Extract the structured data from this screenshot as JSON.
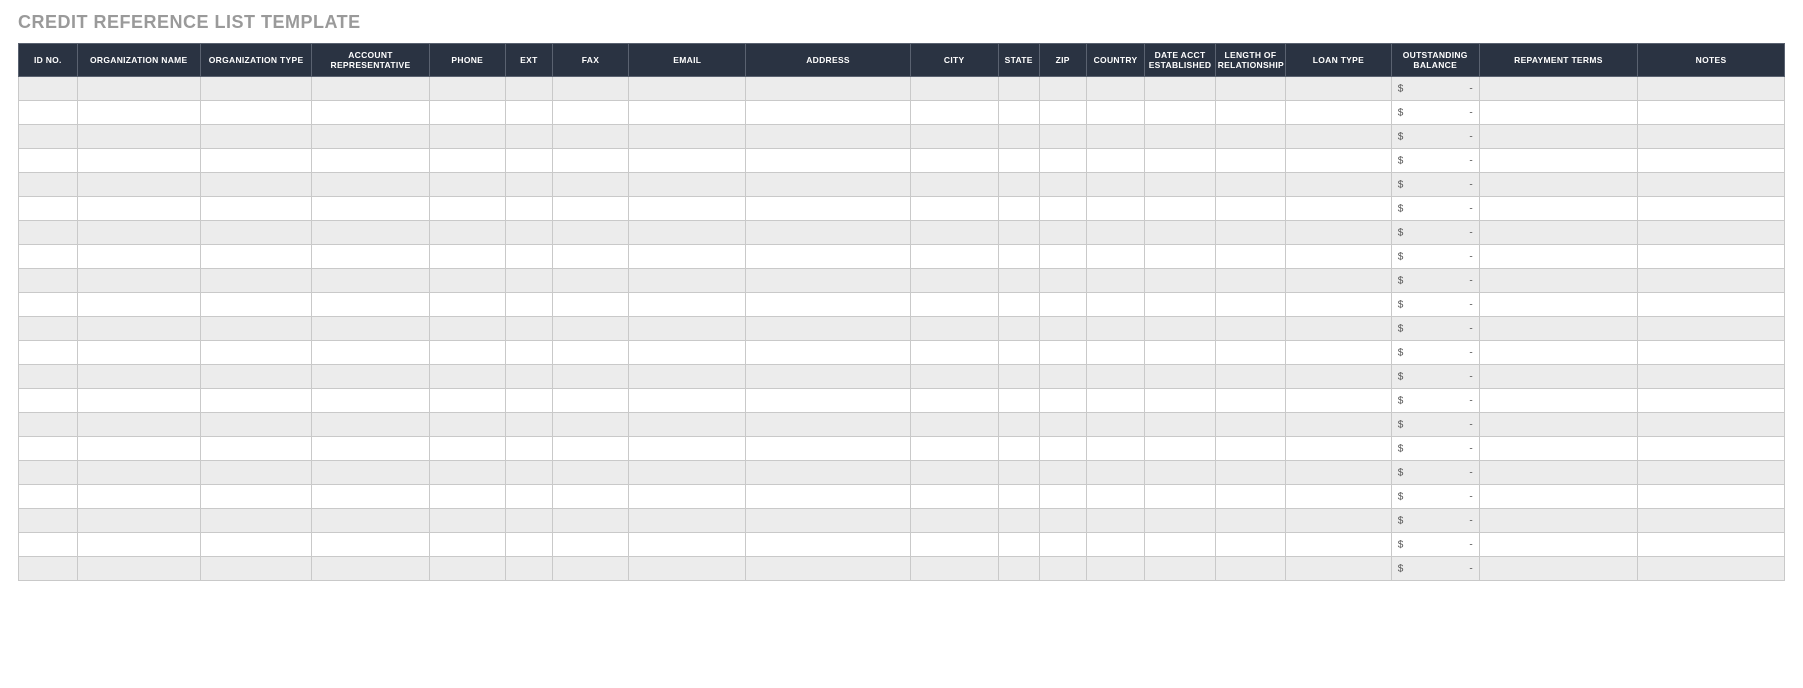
{
  "title": "CREDIT REFERENCE LIST TEMPLATE",
  "columns": [
    "ID NO.",
    "ORGANIZATION NAME",
    "ORGANIZATION TYPE",
    "ACCOUNT REPRESENTATIVE",
    "PHONE",
    "EXT",
    "FAX",
    "EMAIL",
    "ADDRESS",
    "CITY",
    "STATE",
    "ZIP",
    "COUNTRY",
    "DATE ACCT ESTABLISHED",
    "LENGTH OF RELATIONSHIP",
    "LOAN TYPE",
    "OUTSTANDING BALANCE",
    "REPAYMENT TERMS",
    "NOTES"
  ],
  "balance_symbol": "$",
  "balance_placeholder": "-",
  "row_count": 21,
  "rows": [
    {
      "id_no": "",
      "organization_name": "",
      "organization_type": "",
      "account_representative": "",
      "phone": "",
      "ext": "",
      "fax": "",
      "email": "",
      "address": "",
      "city": "",
      "state": "",
      "zip": "",
      "country": "",
      "date_acct_established": "",
      "length_of_relationship": "",
      "loan_type": "",
      "outstanding_balance": "",
      "repayment_terms": "",
      "notes": ""
    },
    {
      "id_no": "",
      "organization_name": "",
      "organization_type": "",
      "account_representative": "",
      "phone": "",
      "ext": "",
      "fax": "",
      "email": "",
      "address": "",
      "city": "",
      "state": "",
      "zip": "",
      "country": "",
      "date_acct_established": "",
      "length_of_relationship": "",
      "loan_type": "",
      "outstanding_balance": "",
      "repayment_terms": "",
      "notes": ""
    },
    {
      "id_no": "",
      "organization_name": "",
      "organization_type": "",
      "account_representative": "",
      "phone": "",
      "ext": "",
      "fax": "",
      "email": "",
      "address": "",
      "city": "",
      "state": "",
      "zip": "",
      "country": "",
      "date_acct_established": "",
      "length_of_relationship": "",
      "loan_type": "",
      "outstanding_balance": "",
      "repayment_terms": "",
      "notes": ""
    },
    {
      "id_no": "",
      "organization_name": "",
      "organization_type": "",
      "account_representative": "",
      "phone": "",
      "ext": "",
      "fax": "",
      "email": "",
      "address": "",
      "city": "",
      "state": "",
      "zip": "",
      "country": "",
      "date_acct_established": "",
      "length_of_relationship": "",
      "loan_type": "",
      "outstanding_balance": "",
      "repayment_terms": "",
      "notes": ""
    },
    {
      "id_no": "",
      "organization_name": "",
      "organization_type": "",
      "account_representative": "",
      "phone": "",
      "ext": "",
      "fax": "",
      "email": "",
      "address": "",
      "city": "",
      "state": "",
      "zip": "",
      "country": "",
      "date_acct_established": "",
      "length_of_relationship": "",
      "loan_type": "",
      "outstanding_balance": "",
      "repayment_terms": "",
      "notes": ""
    },
    {
      "id_no": "",
      "organization_name": "",
      "organization_type": "",
      "account_representative": "",
      "phone": "",
      "ext": "",
      "fax": "",
      "email": "",
      "address": "",
      "city": "",
      "state": "",
      "zip": "",
      "country": "",
      "date_acct_established": "",
      "length_of_relationship": "",
      "loan_type": "",
      "outstanding_balance": "",
      "repayment_terms": "",
      "notes": ""
    },
    {
      "id_no": "",
      "organization_name": "",
      "organization_type": "",
      "account_representative": "",
      "phone": "",
      "ext": "",
      "fax": "",
      "email": "",
      "address": "",
      "city": "",
      "state": "",
      "zip": "",
      "country": "",
      "date_acct_established": "",
      "length_of_relationship": "",
      "loan_type": "",
      "outstanding_balance": "",
      "repayment_terms": "",
      "notes": ""
    },
    {
      "id_no": "",
      "organization_name": "",
      "organization_type": "",
      "account_representative": "",
      "phone": "",
      "ext": "",
      "fax": "",
      "email": "",
      "address": "",
      "city": "",
      "state": "",
      "zip": "",
      "country": "",
      "date_acct_established": "",
      "length_of_relationship": "",
      "loan_type": "",
      "outstanding_balance": "",
      "repayment_terms": "",
      "notes": ""
    },
    {
      "id_no": "",
      "organization_name": "",
      "organization_type": "",
      "account_representative": "",
      "phone": "",
      "ext": "",
      "fax": "",
      "email": "",
      "address": "",
      "city": "",
      "state": "",
      "zip": "",
      "country": "",
      "date_acct_established": "",
      "length_of_relationship": "",
      "loan_type": "",
      "outstanding_balance": "",
      "repayment_terms": "",
      "notes": ""
    },
    {
      "id_no": "",
      "organization_name": "",
      "organization_type": "",
      "account_representative": "",
      "phone": "",
      "ext": "",
      "fax": "",
      "email": "",
      "address": "",
      "city": "",
      "state": "",
      "zip": "",
      "country": "",
      "date_acct_established": "",
      "length_of_relationship": "",
      "loan_type": "",
      "outstanding_balance": "",
      "repayment_terms": "",
      "notes": ""
    },
    {
      "id_no": "",
      "organization_name": "",
      "organization_type": "",
      "account_representative": "",
      "phone": "",
      "ext": "",
      "fax": "",
      "email": "",
      "address": "",
      "city": "",
      "state": "",
      "zip": "",
      "country": "",
      "date_acct_established": "",
      "length_of_relationship": "",
      "loan_type": "",
      "outstanding_balance": "",
      "repayment_terms": "",
      "notes": ""
    },
    {
      "id_no": "",
      "organization_name": "",
      "organization_type": "",
      "account_representative": "",
      "phone": "",
      "ext": "",
      "fax": "",
      "email": "",
      "address": "",
      "city": "",
      "state": "",
      "zip": "",
      "country": "",
      "date_acct_established": "",
      "length_of_relationship": "",
      "loan_type": "",
      "outstanding_balance": "",
      "repayment_terms": "",
      "notes": ""
    },
    {
      "id_no": "",
      "organization_name": "",
      "organization_type": "",
      "account_representative": "",
      "phone": "",
      "ext": "",
      "fax": "",
      "email": "",
      "address": "",
      "city": "",
      "state": "",
      "zip": "",
      "country": "",
      "date_acct_established": "",
      "length_of_relationship": "",
      "loan_type": "",
      "outstanding_balance": "",
      "repayment_terms": "",
      "notes": ""
    },
    {
      "id_no": "",
      "organization_name": "",
      "organization_type": "",
      "account_representative": "",
      "phone": "",
      "ext": "",
      "fax": "",
      "email": "",
      "address": "",
      "city": "",
      "state": "",
      "zip": "",
      "country": "",
      "date_acct_established": "",
      "length_of_relationship": "",
      "loan_type": "",
      "outstanding_balance": "",
      "repayment_terms": "",
      "notes": ""
    },
    {
      "id_no": "",
      "organization_name": "",
      "organization_type": "",
      "account_representative": "",
      "phone": "",
      "ext": "",
      "fax": "",
      "email": "",
      "address": "",
      "city": "",
      "state": "",
      "zip": "",
      "country": "",
      "date_acct_established": "",
      "length_of_relationship": "",
      "loan_type": "",
      "outstanding_balance": "",
      "repayment_terms": "",
      "notes": ""
    },
    {
      "id_no": "",
      "organization_name": "",
      "organization_type": "",
      "account_representative": "",
      "phone": "",
      "ext": "",
      "fax": "",
      "email": "",
      "address": "",
      "city": "",
      "state": "",
      "zip": "",
      "country": "",
      "date_acct_established": "",
      "length_of_relationship": "",
      "loan_type": "",
      "outstanding_balance": "",
      "repayment_terms": "",
      "notes": ""
    },
    {
      "id_no": "",
      "organization_name": "",
      "organization_type": "",
      "account_representative": "",
      "phone": "",
      "ext": "",
      "fax": "",
      "email": "",
      "address": "",
      "city": "",
      "state": "",
      "zip": "",
      "country": "",
      "date_acct_established": "",
      "length_of_relationship": "",
      "loan_type": "",
      "outstanding_balance": "",
      "repayment_terms": "",
      "notes": ""
    },
    {
      "id_no": "",
      "organization_name": "",
      "organization_type": "",
      "account_representative": "",
      "phone": "",
      "ext": "",
      "fax": "",
      "email": "",
      "address": "",
      "city": "",
      "state": "",
      "zip": "",
      "country": "",
      "date_acct_established": "",
      "length_of_relationship": "",
      "loan_type": "",
      "outstanding_balance": "",
      "repayment_terms": "",
      "notes": ""
    },
    {
      "id_no": "",
      "organization_name": "",
      "organization_type": "",
      "account_representative": "",
      "phone": "",
      "ext": "",
      "fax": "",
      "email": "",
      "address": "",
      "city": "",
      "state": "",
      "zip": "",
      "country": "",
      "date_acct_established": "",
      "length_of_relationship": "",
      "loan_type": "",
      "outstanding_balance": "",
      "repayment_terms": "",
      "notes": ""
    },
    {
      "id_no": "",
      "organization_name": "",
      "organization_type": "",
      "account_representative": "",
      "phone": "",
      "ext": "",
      "fax": "",
      "email": "",
      "address": "",
      "city": "",
      "state": "",
      "zip": "",
      "country": "",
      "date_acct_established": "",
      "length_of_relationship": "",
      "loan_type": "",
      "outstanding_balance": "",
      "repayment_terms": "",
      "notes": ""
    },
    {
      "id_no": "",
      "organization_name": "",
      "organization_type": "",
      "account_representative": "",
      "phone": "",
      "ext": "",
      "fax": "",
      "email": "",
      "address": "",
      "city": "",
      "state": "",
      "zip": "",
      "country": "",
      "date_acct_established": "",
      "length_of_relationship": "",
      "loan_type": "",
      "outstanding_balance": "",
      "repayment_terms": "",
      "notes": ""
    }
  ]
}
